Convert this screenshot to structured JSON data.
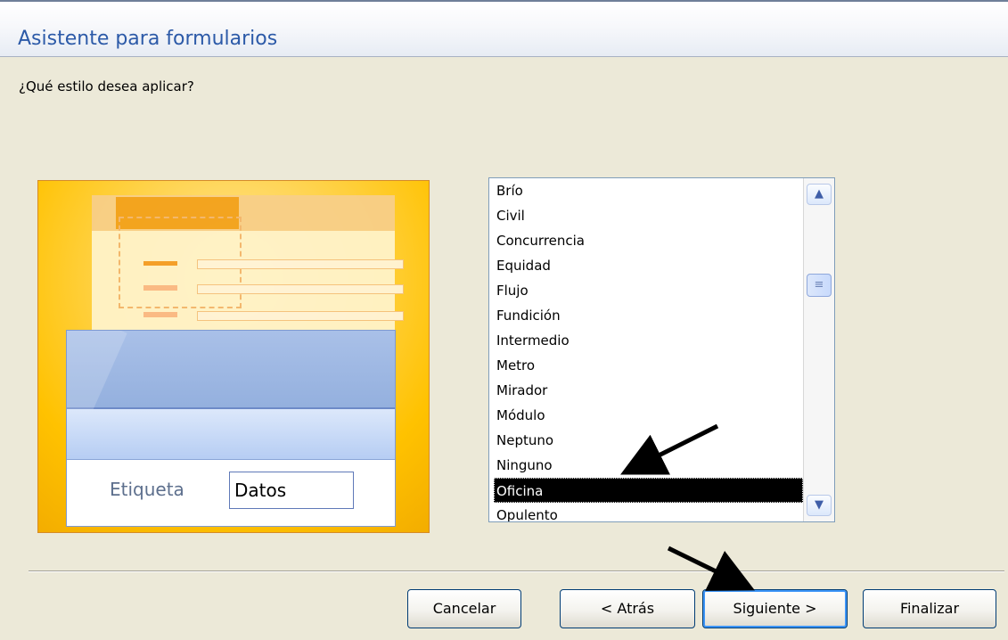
{
  "window": {
    "title": "Asistente para formularios"
  },
  "main": {
    "question": "¿Qué estilo desea aplicar?"
  },
  "preview": {
    "label": "Etiqueta",
    "value": "Datos"
  },
  "style_list": {
    "items": [
      "Brío",
      "Civil",
      "Concurrencia",
      "Equidad",
      "Flujo",
      "Fundición",
      "Intermedio",
      "Metro",
      "Mirador",
      "Módulo",
      "Neptuno",
      "Ninguno",
      "Oficina",
      "Opulento"
    ],
    "selected": "Oficina"
  },
  "buttons": {
    "cancel": "Cancelar",
    "back": "< Atrás",
    "next": "Siguiente >",
    "finish": "Finalizar"
  },
  "colors": {
    "title": "#2c5aa8",
    "preview_bg": "#ffc200",
    "selection": "#000000",
    "button_border": "#003c74"
  },
  "icons": {
    "scroll_up": "chevron-up-icon",
    "scroll_down": "chevron-down-icon",
    "scroll_thumb": "grip-icon",
    "annotation_arrow": "arrow-icon"
  }
}
